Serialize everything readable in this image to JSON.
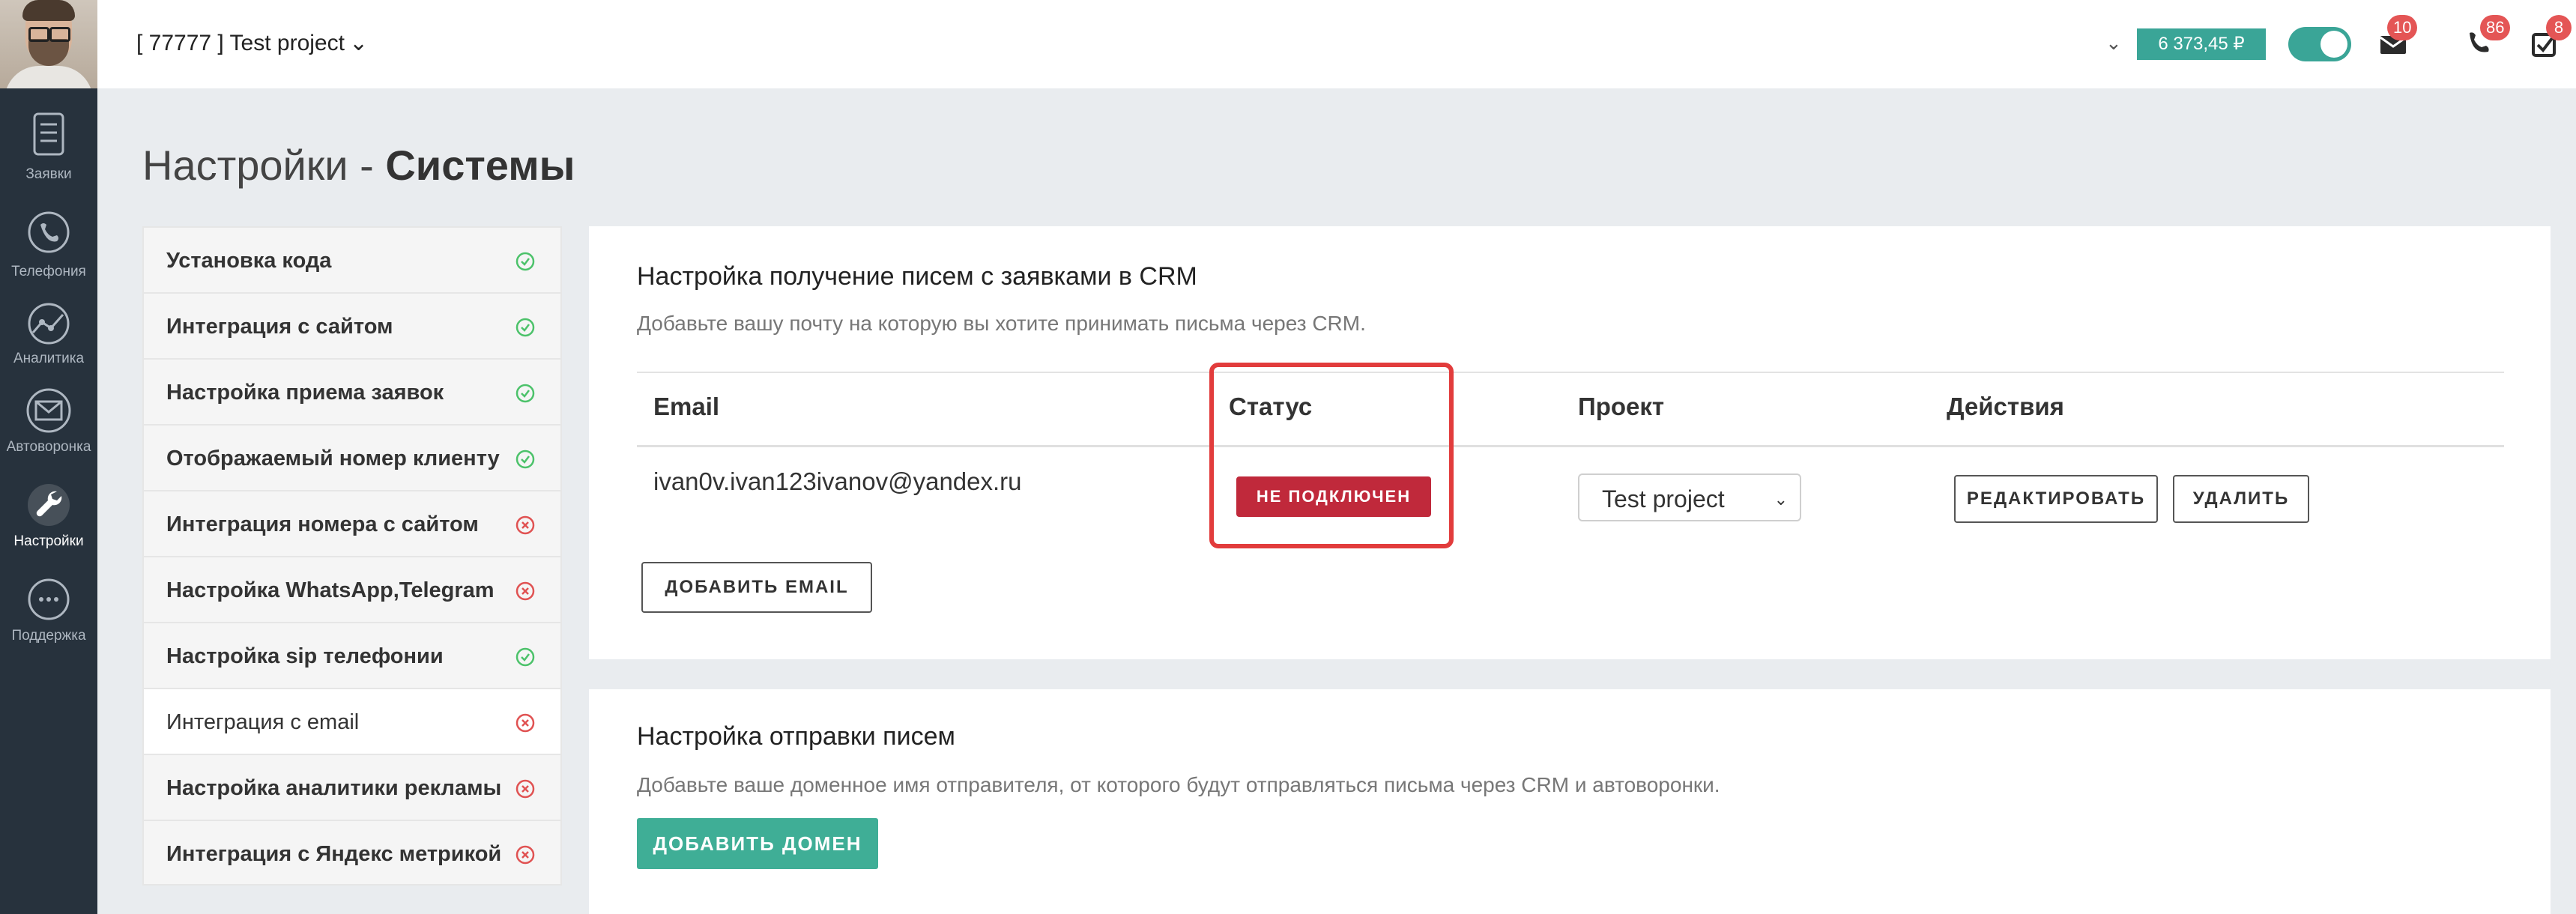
{
  "sidebar": {
    "items": [
      {
        "label": "Заявки",
        "icon": "requests-icon"
      },
      {
        "label": "Телефония",
        "icon": "phone-icon"
      },
      {
        "label": "Аналитика",
        "icon": "analytics-icon"
      },
      {
        "label": "Автоворонка",
        "icon": "mail-funnel-icon"
      },
      {
        "label": "Настройки",
        "icon": "wrench-icon",
        "active": true
      },
      {
        "label": "Поддержка",
        "icon": "chat-support-icon"
      }
    ]
  },
  "header": {
    "project": "[ 77777 ] Test project",
    "balance": "6 373,45 ₽",
    "badges": {
      "mail": "10",
      "calls": "86",
      "tasks": "8"
    }
  },
  "page": {
    "title_prefix": "Настройки - ",
    "title_bold": "Системы"
  },
  "settings_menu": [
    {
      "label": "Установка кода",
      "status": "ok"
    },
    {
      "label": "Интеграция с сайтом",
      "status": "ok"
    },
    {
      "label": "Настройка приема заявок",
      "status": "ok"
    },
    {
      "label": "Отображаемый номер клиенту",
      "status": "ok"
    },
    {
      "label": "Интеграция номера с сайтом",
      "status": "error"
    },
    {
      "label": "Настройка WhatsApp,Telegram",
      "status": "error"
    },
    {
      "label": "Настройка sip телефонии",
      "status": "ok"
    },
    {
      "label": "Интеграция с email",
      "status": "error",
      "active": true
    },
    {
      "label": "Настройка аналитики рекламы",
      "status": "error"
    },
    {
      "label": "Интеграция с Яндекс метрикой",
      "status": "error"
    }
  ],
  "email_receive": {
    "title": "Настройка получение писем с заявками в CRM",
    "description": "Добавьте вашу почту на которую вы хотите принимать письма через CRM.",
    "columns": {
      "email": "Email",
      "status": "Статус",
      "project": "Проект",
      "actions": "Действия"
    },
    "row": {
      "email": "ivan0v.ivan123ivanov@yandex.ru",
      "status": "НЕ ПОДКЛЮЧЕН",
      "project": "Test project",
      "edit": "РЕДАКТИРОВАТЬ",
      "delete": "УДАЛИТЬ"
    },
    "add_button": "ДОБАВИТЬ EMAIL"
  },
  "email_send": {
    "title": "Настройка отправки писем",
    "description": "Добавьте ваше доменное имя отправителя, от которого будут отправляться письма через CRM и автоворонки.",
    "add_button": "ДОБАВИТЬ ДОМЕН"
  },
  "colors": {
    "sidebar": "#27323d",
    "accent": "#3aa597",
    "badge": "#e45555",
    "status_error": "#c0293b",
    "highlight": "#e23c3c",
    "ok": "#4cc26a",
    "error": "#e05252"
  }
}
